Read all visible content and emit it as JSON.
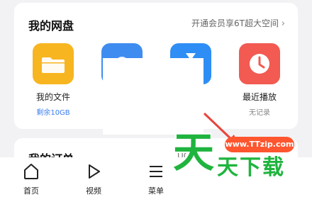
{
  "cloud_card": {
    "title": "我的网盘",
    "promo_link": "开通会员享6T超大空间",
    "chevron": "›",
    "tiles": [
      {
        "label": "我的文件",
        "sub": "剩余10GB",
        "color": "#f7b520",
        "icon": "folder-icon"
      },
      {
        "label": "",
        "sub": "",
        "color": "#3f8cf0",
        "icon": "cloud-icon"
      },
      {
        "label": "",
        "sub": "",
        "color": "#2e8ef5",
        "icon": "hourglass-icon"
      },
      {
        "label": "最近播放",
        "sub": "无记录",
        "color": "#f25a52",
        "icon": "clock-icon"
      }
    ]
  },
  "orders_card": {
    "title": "我的订单",
    "link": "UC"
  },
  "bottom_nav": {
    "items": [
      {
        "label": "首页",
        "icon": "home-icon"
      },
      {
        "label": "视频",
        "icon": "play-icon"
      },
      {
        "label": "菜单",
        "icon": "menu-icon"
      }
    ]
  },
  "watermark": {
    "site": "www.TTzip.com",
    "big_char": "天",
    "small_text": "天下载"
  },
  "colors": {
    "background": "#f2f2f4",
    "card": "#ffffff",
    "sub_blue": "#3a7cf0",
    "sub_gray": "#888888",
    "watermark_green": "#1fb43e",
    "watermark_orange": "#ff5630"
  }
}
